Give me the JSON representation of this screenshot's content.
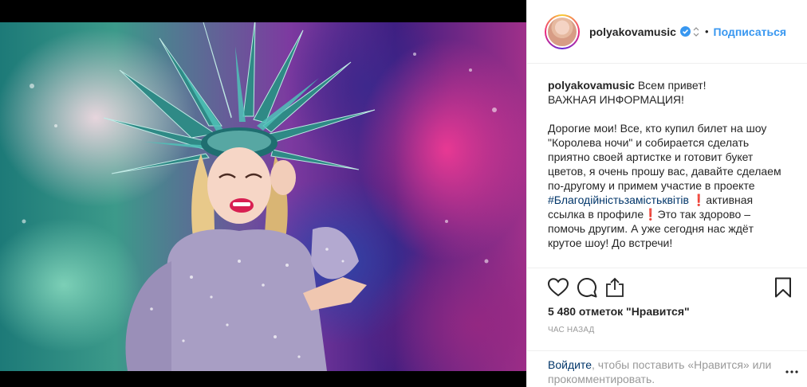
{
  "header": {
    "username": "polyakovamusic",
    "separator": "•",
    "follow_label": "Подписаться"
  },
  "caption": {
    "username": "polyakovamusic",
    "line1": "Всем привет!",
    "line2": "ВАЖНАЯ ИНФОРМАЦИЯ!",
    "para2_before": "Дорогие мои! Все, кто купил билет на шоу \"Королева ночи\" и собирается сделать приятно своей артистке и готовит букет цветов, я очень прошу вас, давайте сделаем по-другому и примем участие в проекте ",
    "hashtag": "#Благодійністьзамістьквітів",
    "para2_after": " ❗️активная ссылка в профиле❗️Это так здорово – помочь другим. А уже сегодня нас ждёт крутое шоу! До встречи!"
  },
  "actions": {
    "like_icon": "heart-icon",
    "comment_icon": "comment-icon",
    "share_icon": "share-icon",
    "save_icon": "bookmark-icon"
  },
  "likes_text": "5 480 отметок \"Нравится\"",
  "timestamp": "час назад",
  "login": {
    "link": "Войдите",
    "rest": ", чтобы поставить «Нравится» или прокомментировать."
  },
  "colors": {
    "link_blue": "#3897f0",
    "hashtag_blue": "#003569",
    "muted": "#999999"
  }
}
